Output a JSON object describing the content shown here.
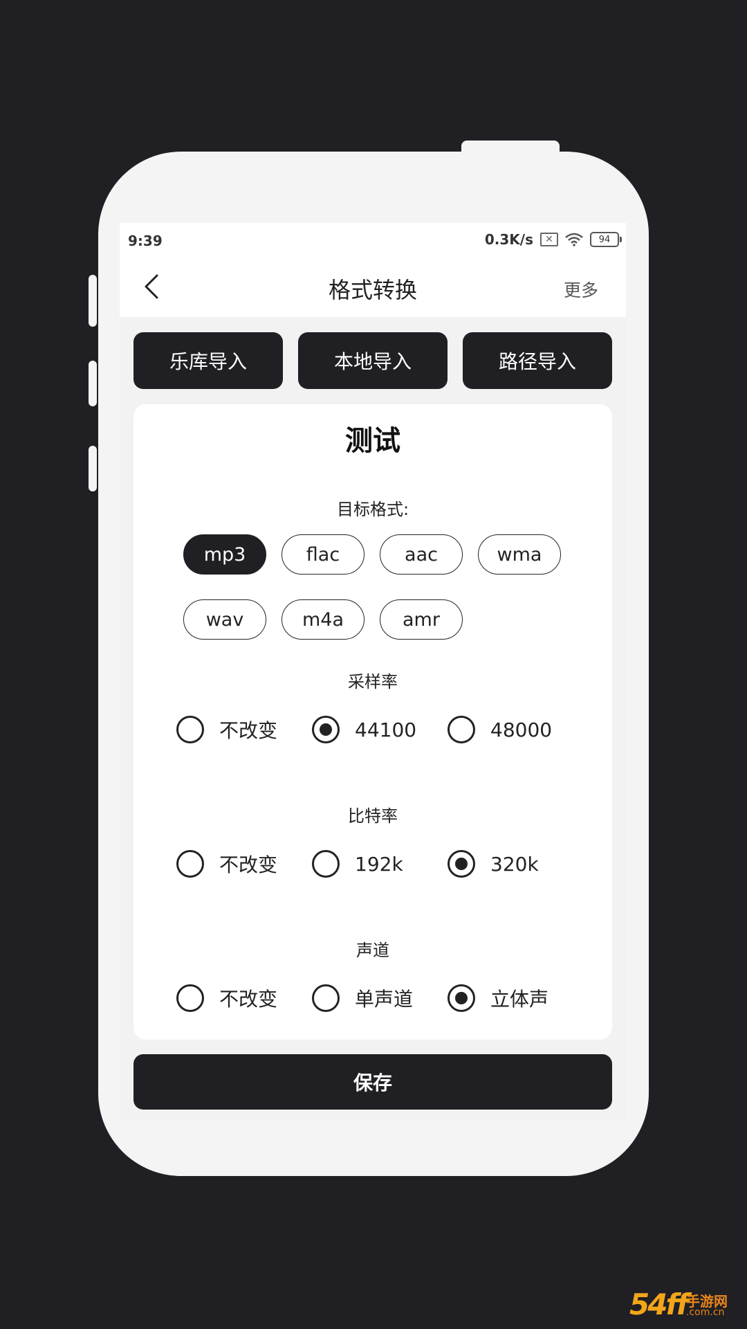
{
  "status_bar": {
    "time": "9:39",
    "speed": "0.3K/s",
    "battery": "94",
    "icons": [
      "sim-x-icon",
      "wifi-icon",
      "battery-icon"
    ]
  },
  "nav": {
    "back_icon": "chevron-left-icon",
    "title": "格式转换",
    "more": "更多"
  },
  "import_buttons": [
    "乐库导入",
    "本地导入",
    "路径导入"
  ],
  "card": {
    "title": "测试",
    "format_label": "目标格式:",
    "formats": [
      "mp3",
      "flac",
      "aac",
      "wma",
      "wav",
      "m4a",
      "amr"
    ],
    "selected_format": "mp3",
    "sample_rate": {
      "label": "采样率",
      "options": [
        "不改变",
        "44100",
        "48000"
      ],
      "selected": "44100"
    },
    "bitrate": {
      "label": "比特率",
      "options": [
        "不改变",
        "192k",
        "320k"
      ],
      "selected": "320k"
    },
    "channel": {
      "label": "声道",
      "options": [
        "不改变",
        "单声道",
        "立体声"
      ],
      "selected": "立体声"
    }
  },
  "save_label": "保存",
  "watermark": {
    "logo": "54ff",
    "text": "手游网",
    "domain": ".com.cn"
  },
  "colors": {
    "background": "#1f1f24",
    "shell": "#f4f4f4",
    "accent": "#1f1f24",
    "watermark": "#f2a51a"
  }
}
